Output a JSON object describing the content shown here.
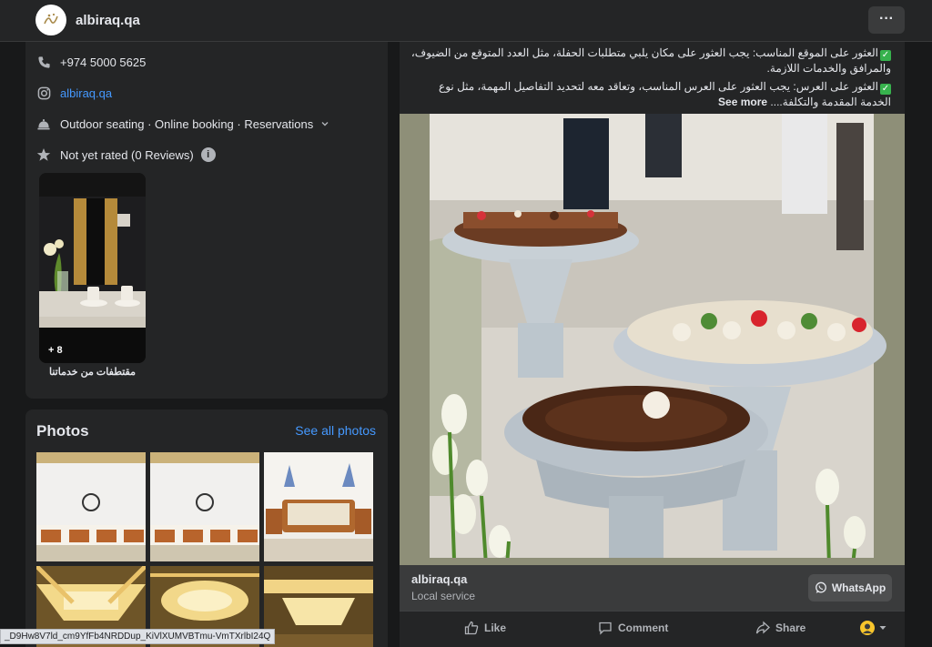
{
  "header": {
    "page_name": "albiraq.qa",
    "more_label": "···"
  },
  "intro": {
    "phone": "+974 5000 5625",
    "instagram": "albiraq.qa",
    "services": "Outdoor seating · Online booking · Reservations",
    "rating": "Not yet rated (0 Reviews)",
    "rating_info": "i",
    "story": {
      "count": "+ 8",
      "caption": "مقتطفات من خدماتنا"
    }
  },
  "photos": {
    "title": "Photos",
    "see_all": "See all photos"
  },
  "post": {
    "line1": "العثور على الموقع المناسب: يجب العثور على مكان يلبي متطلبات الحفلة، مثل العدد المتوقع من الضيوف، والمرافق والخدمات اللازمة.",
    "line2": "العثور على العرس: يجب العثور على العرس المناسب، وتعاقد معه لتحديد التفاصيل المهمة، مثل نوع الخدمة المقدمة والتكلفة....",
    "see_more": "See more",
    "link": {
      "name": "albiraq.qa",
      "category": "Local service",
      "button": "WhatsApp"
    },
    "actions": {
      "like": "Like",
      "comment": "Comment",
      "share": "Share"
    }
  },
  "status_url": "_D9Hw8V7ld_cm9YfFb4NRDDup_KiVlXUMVBTmu-VmTXrlbI24Q",
  "colors": {
    "background": "#18191a",
    "card": "#242526",
    "link": "#4599ff",
    "whatsapp_check": "#37b24d"
  }
}
